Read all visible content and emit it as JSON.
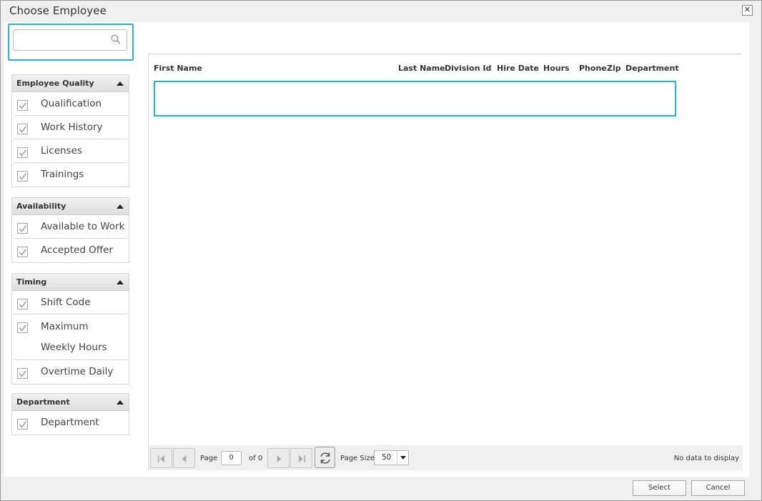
{
  "window": {
    "title": "Choose Employee",
    "close_icon": "close-icon"
  },
  "search": {
    "value": "",
    "placeholder": "",
    "icon": "search-icon"
  },
  "filters": [
    {
      "header": "Employee Quality",
      "items": [
        "Qualification",
        "Work History",
        "Licenses",
        "Trainings"
      ]
    },
    {
      "header": "Availability",
      "items": [
        "Available to Work",
        "Accepted Offer"
      ]
    },
    {
      "header": "Timing",
      "items": [
        "Shift Code",
        "Maximum\nWeekly Hours",
        "Overtime Daily"
      ]
    },
    {
      "header": "Department",
      "items": [
        "Department"
      ]
    }
  ],
  "grid": {
    "columns": [
      "First Name",
      "Last Name",
      "Division Id",
      "Hire Date",
      "Hours",
      "Phone",
      "Zip",
      "Department"
    ],
    "rows": []
  },
  "pager": {
    "page_label": "Page",
    "page_value": "0",
    "of_label": "of 0",
    "page_size_label": "Page Size",
    "page_size_value": "50",
    "status": "No data to display"
  },
  "footer": {
    "select_label": "Select",
    "cancel_label": "Cancel"
  },
  "colors": {
    "highlight": "#2bb3e0",
    "panel_header": "#e4e4e4",
    "background": "#f0f0f0"
  }
}
